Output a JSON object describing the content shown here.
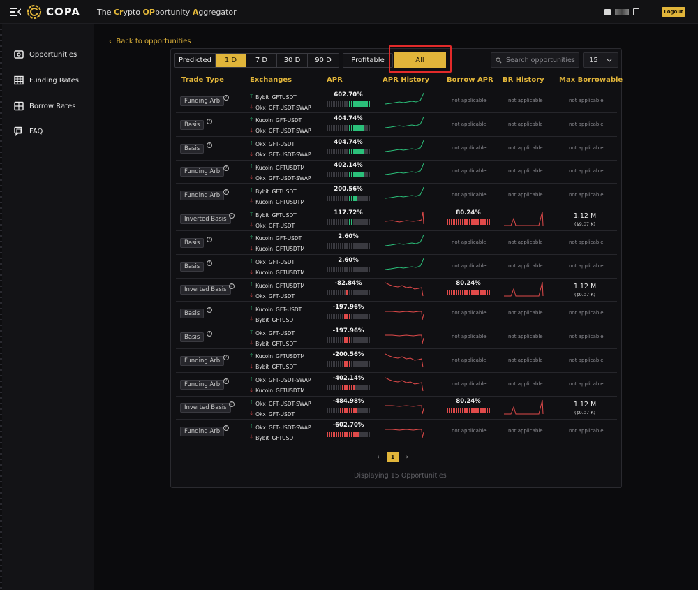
{
  "header": {
    "brand": "COPA",
    "tagline_parts": [
      "The ",
      "Cr",
      "ypto ",
      "OP",
      "portunity ",
      "A",
      "ggregator"
    ],
    "logout_label": "Logout"
  },
  "sidebar": {
    "items": [
      {
        "label": "Opportunities",
        "icon": "wallet-icon"
      },
      {
        "label": "Funding Rates",
        "icon": "table-icon"
      },
      {
        "label": "Borrow Rates",
        "icon": "grid-icon"
      },
      {
        "label": "FAQ",
        "icon": "chat-icon"
      }
    ]
  },
  "back_link": "Back to opportunities",
  "filters": {
    "mode": [
      "Predicted",
      "1 D",
      "7 D",
      "30 D",
      "90 D"
    ],
    "active_mode": "1 D",
    "profitable_label": "Profitable",
    "all_label": "All",
    "search_placeholder": "Search opportunities",
    "per_page": "15"
  },
  "columns": [
    "Trade Type",
    "Exchanges",
    "APR",
    "APR History",
    "Borrow APR",
    "BR History",
    "Max Borrowable"
  ],
  "not_applicable": "not applicable",
  "rows": [
    {
      "type": "Funding Arb",
      "long_ex": "Bybit",
      "long_sym": "GFTUSDT",
      "short_ex": "Okx",
      "short_sym": "GFT-USDT-SWAP",
      "apr": "602.70%",
      "dir": "g",
      "level": 10,
      "spark": "up",
      "borrow": null
    },
    {
      "type": "Basis",
      "long_ex": "Kucoin",
      "long_sym": "GFT-USDT",
      "short_ex": "Okx",
      "short_sym": "GFT-USDT-SWAP",
      "apr": "404.74%",
      "dir": "g",
      "level": 7,
      "spark": "up",
      "borrow": null
    },
    {
      "type": "Basis",
      "long_ex": "Okx",
      "long_sym": "GFT-USDT",
      "short_ex": "Okx",
      "short_sym": "GFT-USDT-SWAP",
      "apr": "404.74%",
      "dir": "g",
      "level": 7,
      "spark": "up",
      "borrow": null
    },
    {
      "type": "Funding Arb",
      "long_ex": "Kucoin",
      "long_sym": "GFTUSDTM",
      "short_ex": "Okx",
      "short_sym": "GFT-USDT-SWAP",
      "apr": "402.14%",
      "dir": "g",
      "level": 7,
      "spark": "up",
      "borrow": null
    },
    {
      "type": "Funding Arb",
      "long_ex": "Bybit",
      "long_sym": "GFTUSDT",
      "short_ex": "Kucoin",
      "short_sym": "GFTUSDTM",
      "apr": "200.56%",
      "dir": "g",
      "level": 4,
      "spark": "up",
      "borrow": null
    },
    {
      "type": "Inverted Basis",
      "long_ex": "Bybit",
      "long_sym": "GFTUSDT",
      "short_ex": "Okx",
      "short_sym": "GFT-USDT",
      "apr": "117.72%",
      "dir": "g",
      "level": 2,
      "spark": "flat",
      "borrow": {
        "apr": "80.24%",
        "max": "1.12 M",
        "max_usd": "($9.07 K)"
      }
    },
    {
      "type": "Basis",
      "long_ex": "Kucoin",
      "long_sym": "GFT-USDT",
      "short_ex": "Kucoin",
      "short_sym": "GFTUSDTM",
      "apr": "2.60%",
      "dir": "g",
      "level": 0,
      "spark": "up",
      "borrow": null
    },
    {
      "type": "Basis",
      "long_ex": "Okx",
      "long_sym": "GFT-USDT",
      "short_ex": "Kucoin",
      "short_sym": "GFTUSDTM",
      "apr": "2.60%",
      "dir": "g",
      "level": 0,
      "spark": "up",
      "borrow": null
    },
    {
      "type": "Inverted Basis",
      "long_ex": "Kucoin",
      "long_sym": "GFTUSDTM",
      "short_ex": "Okx",
      "short_sym": "GFT-USDT",
      "apr": "-82.84%",
      "dir": "r",
      "level": 1,
      "spark": "down",
      "borrow": {
        "apr": "80.24%",
        "max": "1.12 M",
        "max_usd": "($9.07 K)"
      }
    },
    {
      "type": "Basis",
      "long_ex": "Kucoin",
      "long_sym": "GFT-USDT",
      "short_ex": "Bybit",
      "short_sym": "GFTUSDT",
      "apr": "-197.96%",
      "dir": "r",
      "level": 3,
      "spark": "flatdrop",
      "borrow": null
    },
    {
      "type": "Basis",
      "long_ex": "Okx",
      "long_sym": "GFT-USDT",
      "short_ex": "Bybit",
      "short_sym": "GFTUSDT",
      "apr": "-197.96%",
      "dir": "r",
      "level": 3,
      "spark": "flatdrop",
      "borrow": null
    },
    {
      "type": "Funding Arb",
      "long_ex": "Kucoin",
      "long_sym": "GFTUSDTM",
      "short_ex": "Bybit",
      "short_sym": "GFTUSDT",
      "apr": "-200.56%",
      "dir": "r",
      "level": 3,
      "spark": "down",
      "borrow": null
    },
    {
      "type": "Funding Arb",
      "long_ex": "Okx",
      "long_sym": "GFT-USDT-SWAP",
      "short_ex": "Kucoin",
      "short_sym": "GFTUSDTM",
      "apr": "-402.14%",
      "dir": "r",
      "level": 6,
      "spark": "down",
      "borrow": null
    },
    {
      "type": "Inverted Basis",
      "long_ex": "Okx",
      "long_sym": "GFT-USDT-SWAP",
      "short_ex": "Okx",
      "short_sym": "GFT-USDT",
      "apr": "-484.98%",
      "dir": "r",
      "level": 8,
      "spark": "flatdrop",
      "borrow": {
        "apr": "80.24%",
        "max": "1.12 M",
        "max_usd": "($9.07 K)"
      }
    },
    {
      "type": "Funding Arb",
      "long_ex": "Okx",
      "long_sym": "GFT-USDT-SWAP",
      "short_ex": "Bybit",
      "short_sym": "GFTUSDT",
      "apr": "-602.70%",
      "dir": "r",
      "level": 10,
      "spark": "flatdrop",
      "borrow": null
    }
  ],
  "pagination": {
    "prev": "‹",
    "current": "1",
    "next": "›"
  },
  "footer": "Displaying 15 Opportunities",
  "colors": {
    "accent": "#e1b53a",
    "up": "#2bc07a",
    "down": "#e04a4a",
    "highlight": "#e22a2a"
  }
}
